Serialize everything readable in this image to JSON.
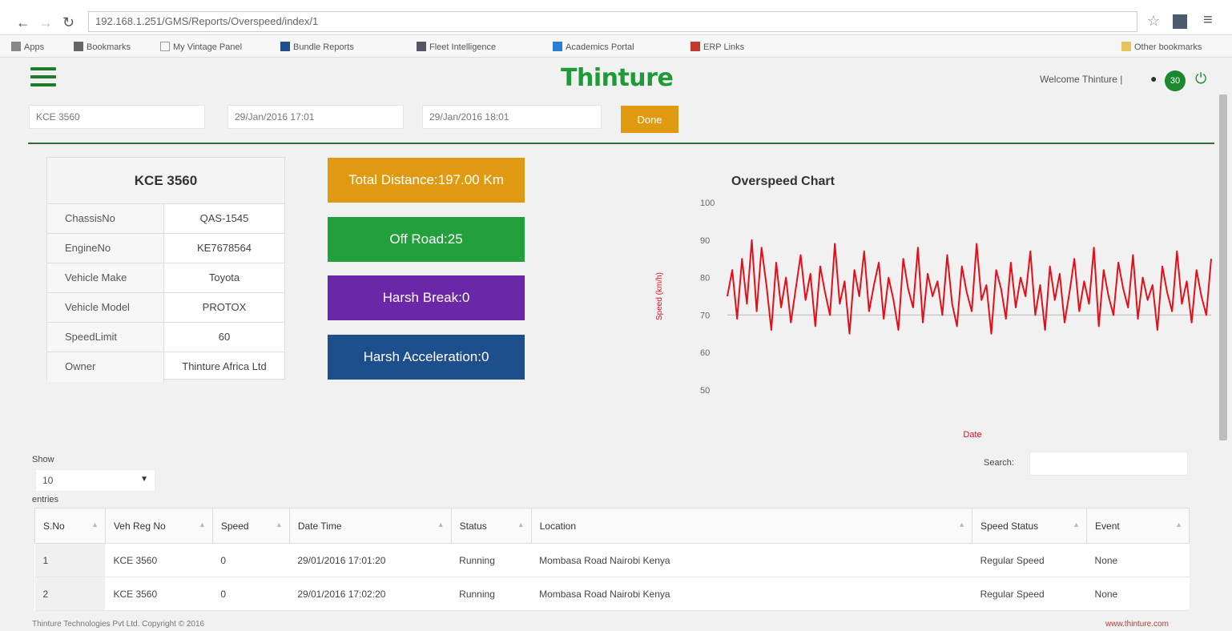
{
  "browser": {
    "url": "192.168.1.251/GMS/Reports/Overspeed/index/1",
    "bookmarks": [
      "Apps",
      "Bookmarks",
      "My Vintage Panel",
      "Bundle Reports",
      "Fleet Intelligence",
      "Academics Portal",
      "ERP Links",
      "Other bookmarks"
    ]
  },
  "header": {
    "brand": "Thinture",
    "welcome": "Welcome Thinture |",
    "notification_count": "30"
  },
  "filters": {
    "vehicle": "KCE 3560",
    "from": "29/Jan/2016 17:01",
    "to": "29/Jan/2016 18:01",
    "go_label": "Done"
  },
  "vehicle": {
    "title": "KCE 3560",
    "rows": [
      {
        "label": "ChassisNo",
        "value": "QAS-1545"
      },
      {
        "label": "EngineNo",
        "value": "KE7678564"
      },
      {
        "label": "Vehicle Make",
        "value": "Toyota"
      },
      {
        "label": "Vehicle Model",
        "value": "PROTOX"
      },
      {
        "label": "SpeedLimit",
        "value": "60"
      },
      {
        "label": "Owner",
        "value": "Thinture Africa Ltd"
      }
    ]
  },
  "tiles": {
    "distance": "Total Distance:197.00 Km",
    "offroad": "Off Road:25",
    "harsh_break": "Harsh Break:0",
    "harsh_accel": "Harsh Acceleration:0"
  },
  "colors": {
    "brand_green": "#1e9b38",
    "orange": "#e09a12",
    "green_tile": "#21a03b",
    "purple_tile": "#6a27a8",
    "blue_tile": "#1d4f8c",
    "chart_line": "#e3101a"
  },
  "chart_data": {
    "type": "line",
    "title": "Overspeed Chart",
    "ylabel": "Speed (km/h)",
    "xlabel": "Date",
    "ylim": [
      50,
      100
    ],
    "yticks": [
      "100",
      "90",
      "80",
      "70",
      "60",
      "50"
    ],
    "series": [
      {
        "values": [
          75,
          82,
          69,
          85,
          73,
          90,
          71,
          88,
          78,
          66,
          84,
          72,
          80,
          68,
          77,
          86,
          74,
          81,
          67,
          83,
          76,
          70,
          89,
          73,
          79,
          65,
          82,
          75,
          87,
          71,
          78,
          84,
          69,
          80,
          74,
          66,
          85,
          77,
          72,
          88,
          68,
          81,
          75,
          79,
          70,
          86,
          73,
          67,
          83,
          76,
          71,
          89,
          74,
          78,
          65,
          82,
          77,
          69,
          84,
          72,
          80,
          75,
          87,
          70,
          78,
          66,
          83,
          74,
          81,
          68,
          76,
          85,
          71,
          79,
          73,
          88,
          67,
          82,
          75,
          70,
          84,
          77,
          72,
          86,
          69,
          80,
          74,
          78,
          66,
          83,
          76,
          71,
          87,
          73,
          79,
          68,
          82,
          75,
          70,
          85
        ]
      }
    ]
  },
  "table_controls": {
    "show_label": "Show",
    "show_value": "10",
    "entries_label": "entries",
    "search_label": "Search:"
  },
  "table": {
    "headers": [
      "S.No",
      "Veh Reg No",
      "Speed",
      "Date Time",
      "Status",
      "Location",
      "Speed Status",
      "Event"
    ],
    "rows": [
      [
        "1",
        "KCE 3560",
        "0",
        "29/01/2016 17:01:20",
        "Running",
        "Mombasa Road Nairobi Kenya",
        "Regular Speed",
        "None"
      ],
      [
        "2",
        "KCE 3560",
        "0",
        "29/01/2016 17:02:20",
        "Running",
        "Mombasa Road Nairobi Kenya",
        "Regular Speed",
        "None"
      ]
    ]
  },
  "footer": {
    "left": "Thinture Technologies Pvt Ltd. Copyright © 2016",
    "right": "www.thinture.com"
  }
}
